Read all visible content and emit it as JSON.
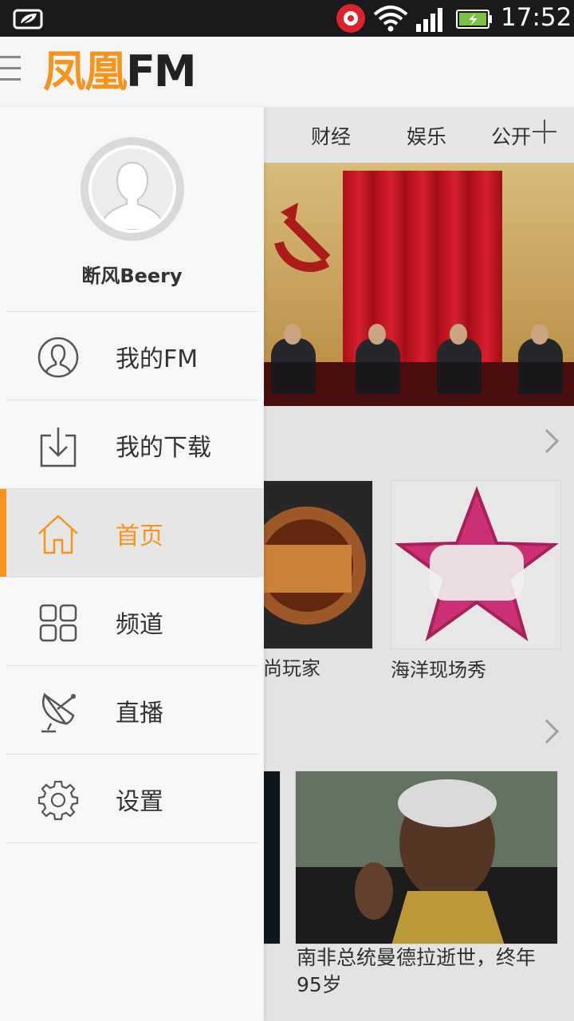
{
  "status_bar": {
    "time": "17:52",
    "icons": [
      "leaf-notification-icon",
      "beats-audio-icon",
      "wifi-icon",
      "signal-icon",
      "battery-charging-icon"
    ]
  },
  "header": {
    "logo_cn": "凤凰",
    "logo_en": "FM",
    "menu_icon": "hamburger-icon"
  },
  "tabs": [
    "财经",
    "娱乐",
    "公开"
  ],
  "drawer": {
    "username": "断风Beery",
    "items": [
      {
        "label": "我的FM",
        "icon": "user-circle-icon",
        "active": false
      },
      {
        "label": "我的下载",
        "icon": "download-icon",
        "active": false
      },
      {
        "label": "首页",
        "icon": "home-icon",
        "active": true
      },
      {
        "label": "频道",
        "icon": "grid-icon",
        "active": false
      },
      {
        "label": "直播",
        "icon": "satellite-dish-icon",
        "active": false
      },
      {
        "label": "设置",
        "icon": "gear-icon",
        "active": false
      }
    ]
  },
  "main": {
    "banner_dots": 5,
    "banner_active_dot": 0,
    "programs": [
      {
        "title": "尚玩家"
      },
      {
        "title": "海洋现场秀"
      }
    ],
    "news": [
      {
        "title": "南非总统曼德拉逝世，终年95岁"
      }
    ]
  },
  "colors": {
    "accent": "#f7941d",
    "status_bar": "#1a1a1a",
    "drawer_bg": "#f7f7f7",
    "active_item_bg": "#e6e6e6"
  }
}
